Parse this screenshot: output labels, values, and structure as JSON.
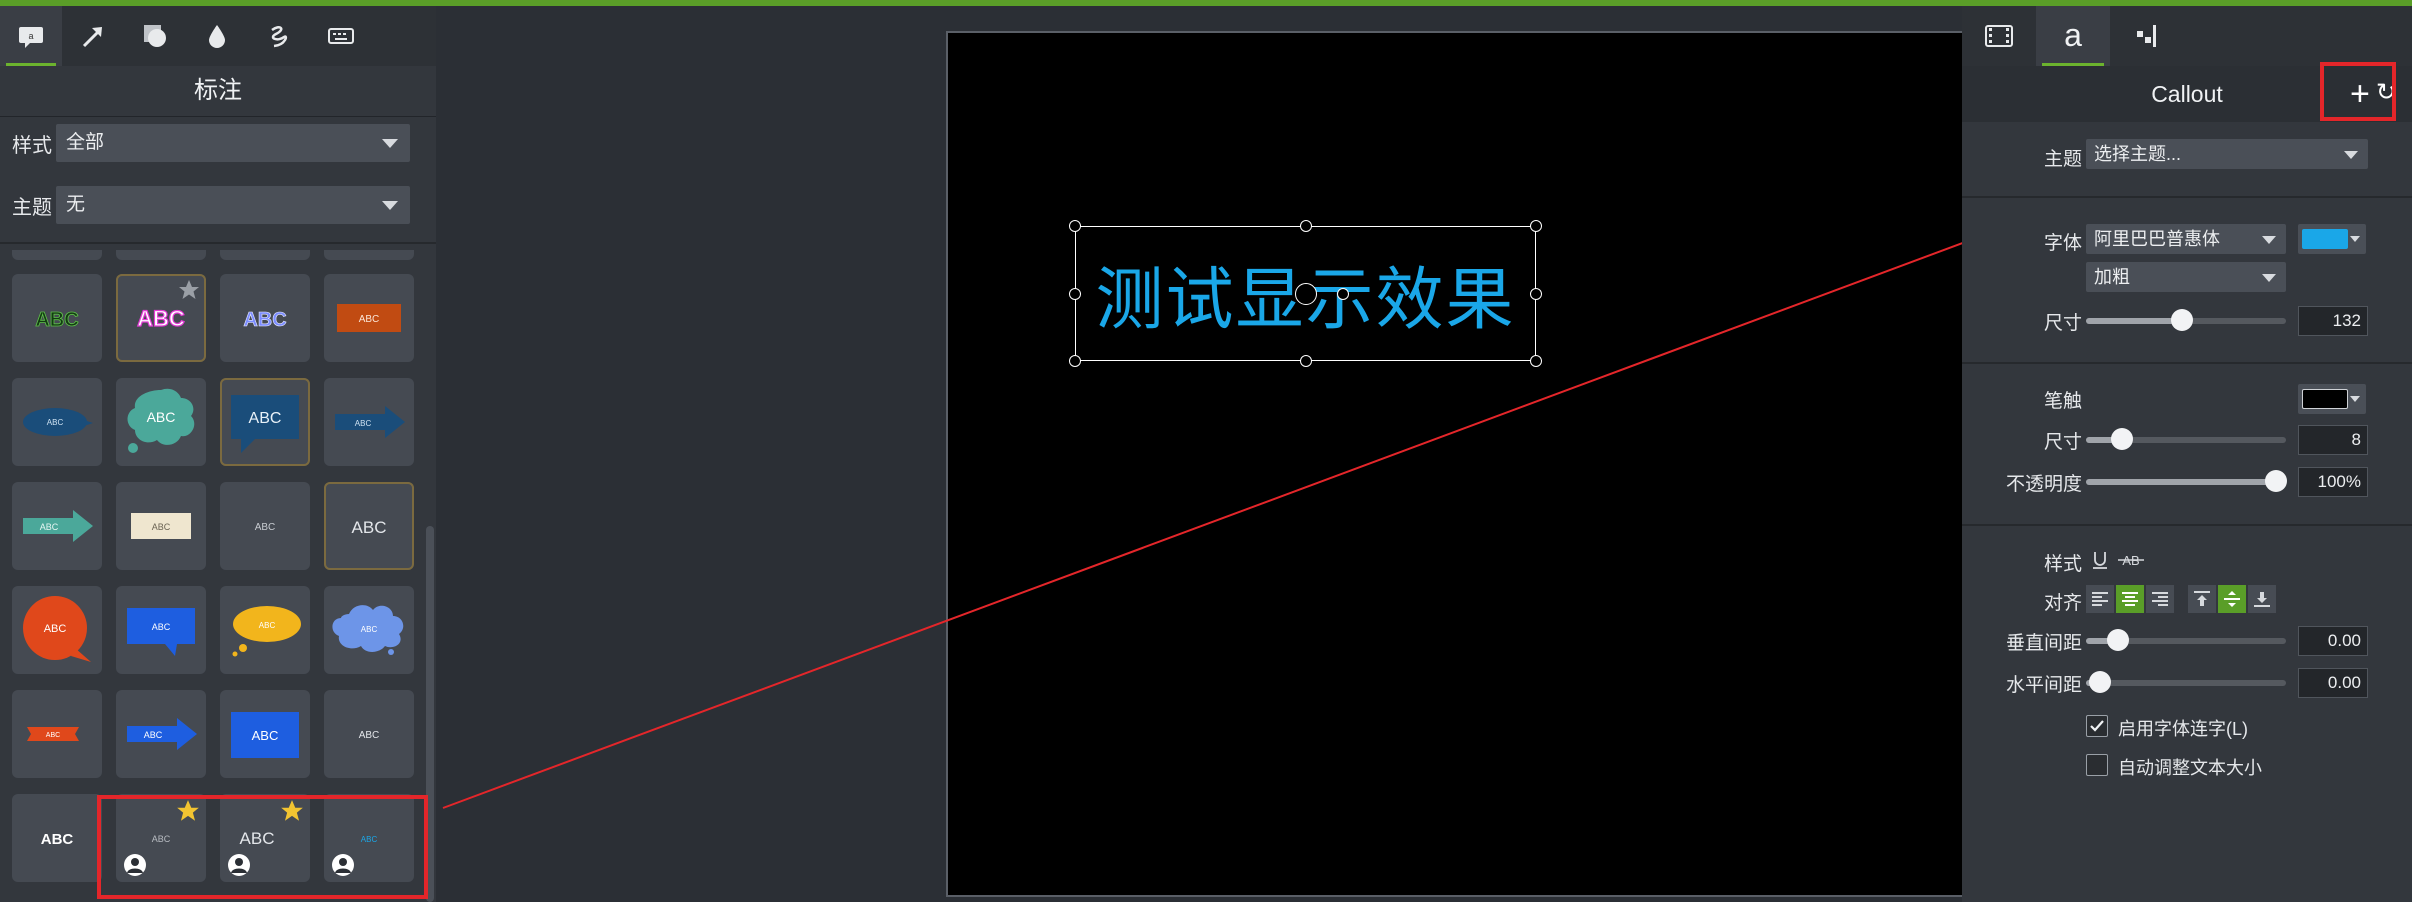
{
  "left_panel": {
    "title": "标注",
    "tabs": [
      "annotation-icon",
      "arrow-icon",
      "shape-icon",
      "blur-icon",
      "sketch-motion-icon",
      "keystroke-icon"
    ],
    "style_filter": {
      "label": "样式",
      "value": "全部"
    },
    "theme_filter": {
      "label": "主题",
      "value": "无"
    },
    "cells": [
      {
        "text": "ABC"
      },
      {
        "text": "ABC"
      },
      {
        "text": "ABC"
      },
      {
        "text": "ABC"
      },
      {
        "text": "ABC"
      },
      {
        "text": "ABC"
      },
      {
        "text": "ABC"
      },
      {
        "text": "ABC"
      },
      {
        "text": "ABC"
      },
      {
        "text": "ABC"
      },
      {
        "text": "ABC"
      },
      {
        "text": "ABC"
      },
      {
        "text": "ABC"
      },
      {
        "text": "ABC"
      },
      {
        "text": "ABC"
      },
      {
        "text": "ABC"
      },
      {
        "text": "ABC"
      },
      {
        "text": "ABC"
      },
      {
        "text": "ABC"
      },
      {
        "text": "ABC"
      },
      {
        "text": "ABC"
      },
      {
        "text": "ABC"
      },
      {
        "text": "ABC"
      },
      {
        "text": "ABC"
      }
    ]
  },
  "canvas": {
    "callout_text": "测试显示效果",
    "text_color": "#1aa7e8"
  },
  "right_panel": {
    "title": "Callout",
    "add_label": "+",
    "reset_label": "↻",
    "theme": {
      "label": "主题",
      "value": "选择主题..."
    },
    "font": {
      "label": "字体",
      "family": "阿里巴巴普惠体",
      "weight": "加粗",
      "color": "#1aa7e8"
    },
    "font_size": {
      "label": "尺寸",
      "value": "132",
      "position": 0.5
    },
    "stroke": {
      "label": "笔触",
      "color": "#000000"
    },
    "stroke_size": {
      "label": "尺寸",
      "value": "8",
      "position": 0.18
    },
    "opacity": {
      "label": "不透明度",
      "value": "100%",
      "position": 1.0
    },
    "text_style": {
      "label": "样式"
    },
    "align": {
      "label": "对齐"
    },
    "vertical_spacing": {
      "label": "垂直间距",
      "value": "0.00",
      "position": 0.16
    },
    "horizontal_spacing": {
      "label": "水平间距",
      "value": "0.00",
      "position": 0.07
    },
    "ligature": {
      "label": "启用字体连字(L)",
      "checked": true
    },
    "auto_resize": {
      "label": "自动调整文本大小",
      "checked": false
    }
  }
}
